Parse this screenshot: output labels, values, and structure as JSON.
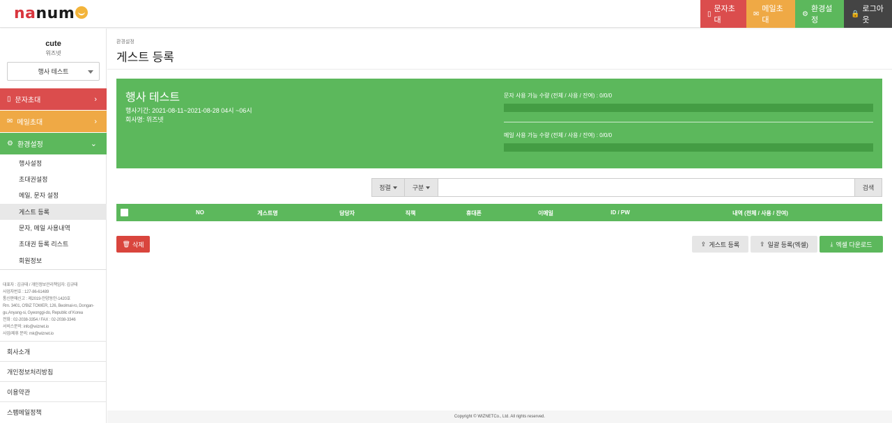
{
  "brand": {
    "logo_part1": "na",
    "logo_part2": "num",
    "logo_part3": "e"
  },
  "topbar": {
    "sms_invite": "문자초대",
    "mail_invite": "메일초대",
    "settings": "환경설정",
    "logout": "로그아웃"
  },
  "user": {
    "name": "cute",
    "company": "위즈넷"
  },
  "event_select": {
    "selected": "행사 테스트"
  },
  "menu": {
    "sms": "문자초대",
    "mail": "메일초대",
    "settings": "환경설정",
    "sub": [
      "행사설정",
      "초대권설정",
      "메일, 문자 설정",
      "게스트 등록",
      "문자, 메일 사용내역",
      "초대권 등록 리스트",
      "회원정보"
    ]
  },
  "company_info": [
    "대표자 : 김규태 / 개인정보관리책임자: 김규태",
    "사업자번호 : 127-86-61489",
    "통신판매신고 : 제2019-안양동안-1420호",
    "Rm. 3401, O'BIZ TOWER, 126, Beolmal-ro, Dongan-",
    "gu,Anyang-si, Gyeonggi-do, Republic of Korea",
    "전화 : 02-2038-3354 / FAX : 02-2038-3346",
    "서비스문의: info@wiznet.io",
    "사업/제휴 문의: mk@wiznet.io"
  ],
  "footer_links": [
    "회사소개",
    "개인정보처리방침",
    "이용약관",
    "스팸메일정책"
  ],
  "page": {
    "breadcrumb": "환경설정",
    "title": "게스트 등록"
  },
  "event": {
    "name": "행사 테스트",
    "period": "행사기간: 2021-08-11~2021-08-28 04시 ~06시",
    "company": "회사명: 위즈넷",
    "sms_quota": "문자 사용 가능 수량 (전체 / 사용 / 잔여) : 0/0/0",
    "sms_quota_fraction": 0,
    "mail_quota": "메일 사용 가능 수량 (전체 / 사용 / 잔여) : 0/0/0",
    "mail_quota_fraction": 0
  },
  "search": {
    "sort_label": "정렬",
    "category_label": "구분",
    "query": "",
    "button": "검색"
  },
  "table": {
    "columns": [
      "NO",
      "게스트명",
      "담당자",
      "직책",
      "휴대폰",
      "이메일",
      "ID / PW",
      "내역 (전체 / 사용 / 잔여)"
    ],
    "rows": []
  },
  "actions": {
    "delete": "삭제",
    "guest_register": "게스트 등록",
    "bulk_register": "일괄 등록(엑셀)",
    "excel_download": "엑셀 다운로드"
  },
  "copyright": "Copyright © WIZNETCo., Ltd. All rights reserved.",
  "colors": {
    "red": "#db4d4d",
    "orange": "#efa945",
    "green": "#5cb85c",
    "dark": "#444444"
  }
}
